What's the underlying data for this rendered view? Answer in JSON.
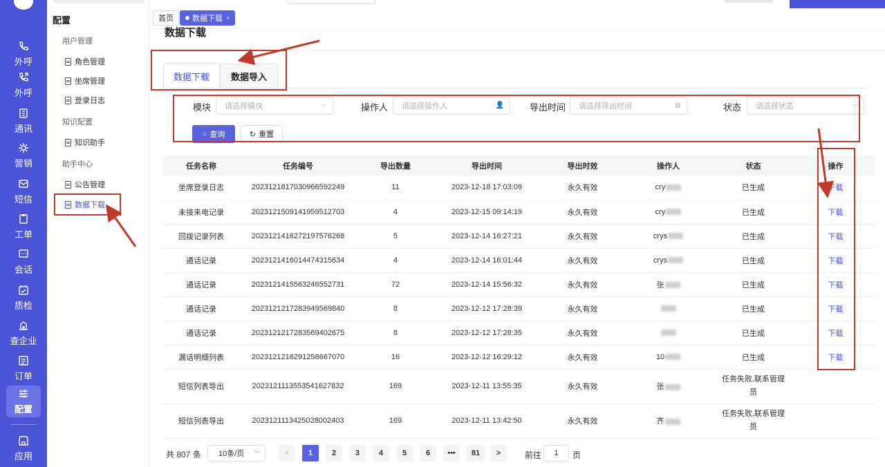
{
  "rail": [
    {
      "label": "外呼",
      "icon": "phone-icon"
    },
    {
      "label": "外呼",
      "icon": "phone-outgoing-icon"
    },
    {
      "label": "通讯",
      "icon": "contacts-icon"
    },
    {
      "label": "营销",
      "icon": "marketing-icon"
    },
    {
      "label": "短信",
      "icon": "sms-icon"
    },
    {
      "label": "工单",
      "icon": "ticket-icon"
    },
    {
      "label": "会话",
      "icon": "chat-icon"
    },
    {
      "label": "质检",
      "icon": "quality-icon"
    },
    {
      "label": "查企业",
      "icon": "enterprise-icon"
    },
    {
      "label": "订单",
      "icon": "order-icon"
    },
    {
      "label": "配置",
      "icon": "settings-sliders-icon"
    },
    {
      "label": "应用",
      "icon": "app-store-icon"
    }
  ],
  "sidebar": {
    "title": "配置",
    "groups": [
      {
        "label": "用户管理",
        "items": [
          "角色管理",
          "坐席管理",
          "登录日志"
        ]
      },
      {
        "label": "知识配置",
        "items": [
          "知识助手"
        ]
      },
      {
        "label": "助手中心",
        "items": [
          "公告管理",
          "数据下载"
        ]
      }
    ],
    "active_item": "数据下载"
  },
  "tabs": {
    "home": "首页",
    "current": "数据下载",
    "close": "×"
  },
  "page": {
    "title": "数据下载",
    "subtabs": [
      "数据下载",
      "数据导入"
    ]
  },
  "filters": {
    "module_label": "模块",
    "module_placeholder": "请选择模块",
    "operator_label": "操作人",
    "operator_placeholder": "请选择操作人",
    "export_time_label": "导出时间",
    "export_time_placeholder": "请选择导出时间",
    "status_label": "状态",
    "status_placeholder": "请选择状态",
    "query_button": "查询",
    "reset_button": "重置"
  },
  "table": {
    "columns": [
      "任务名称",
      "任务编号",
      "导出数量",
      "导出时间",
      "导出时效",
      "操作人",
      "状态",
      "操作"
    ],
    "rows": [
      {
        "name": "坐席登录日志",
        "id": "2023121817030966592249",
        "count": "11",
        "time": "2023-12-18 17:03:09",
        "validity": "永久有效",
        "operator": "cry",
        "status": "已生成",
        "action": "下载"
      },
      {
        "name": "未接来电记录",
        "id": "2023121509141959512703",
        "count": "4",
        "time": "2023-12-15 09:14:19",
        "validity": "永久有效",
        "operator": "cry",
        "status": "已生成",
        "action": "下载"
      },
      {
        "name": "回拨记录列表",
        "id": "2023121416272197576268",
        "count": "5",
        "time": "2023-12-14 16:27:21",
        "validity": "永久有效",
        "operator": "crys",
        "status": "已生成",
        "action": "下载"
      },
      {
        "name": "通话记录",
        "id": "2023121416014474315634",
        "count": "4",
        "time": "2023-12-14 16:01:44",
        "validity": "永久有效",
        "operator": "crys",
        "status": "已生成",
        "action": "下载"
      },
      {
        "name": "通话记录",
        "id": "2023121415563246552731",
        "count": "72",
        "time": "2023-12-14 15:56:32",
        "validity": "永久有效",
        "operator": "张",
        "status": "已生成",
        "action": "下载"
      },
      {
        "name": "通话记录",
        "id": "2023121217283949569840",
        "count": "8",
        "time": "2023-12-12 17:28:39",
        "validity": "永久有效",
        "operator": "",
        "status": "已生成",
        "action": "下载"
      },
      {
        "name": "通话记录",
        "id": "2023121217283569402675",
        "count": "8",
        "time": "2023-12-12 17:28:35",
        "validity": "永久有效",
        "operator": "",
        "status": "已生成",
        "action": "下载"
      },
      {
        "name": "漏话明细列表",
        "id": "2023121216291258667070",
        "count": "16",
        "time": "2023-12-12 16:29:12",
        "validity": "永久有效",
        "operator": "10",
        "status": "已生成",
        "action": "下载"
      },
      {
        "name": "短信列表导出",
        "id": "2023121113553541627832",
        "count": "169",
        "time": "2023-12-11 13:55:35",
        "validity": "永久有效",
        "operator": "张",
        "status": "任务失败,联系管理员",
        "status_line1": "任务失败,联系管理",
        "status_line2": "员",
        "action": ""
      },
      {
        "name": "短信列表导出",
        "id": "2023121113425028002403",
        "count": "169",
        "time": "2023-12-11 13:42:50",
        "validity": "永久有效",
        "operator": "齐",
        "status": "任务失败,联系管理员",
        "status_line1": "任务失败,联系管理",
        "status_line2": "员",
        "action": ""
      }
    ]
  },
  "pagination": {
    "total": "共 807 条",
    "page_size": "10条/页",
    "pages": [
      "1",
      "2",
      "3",
      "4",
      "5",
      "6",
      "•••",
      "81"
    ],
    "current": "1",
    "prev": "<",
    "next": ">",
    "goto_label": "前往",
    "goto_value": "1",
    "goto_suffix": "页"
  },
  "colors": {
    "brand": "#4b53d6",
    "annotation": "#c0392b"
  }
}
